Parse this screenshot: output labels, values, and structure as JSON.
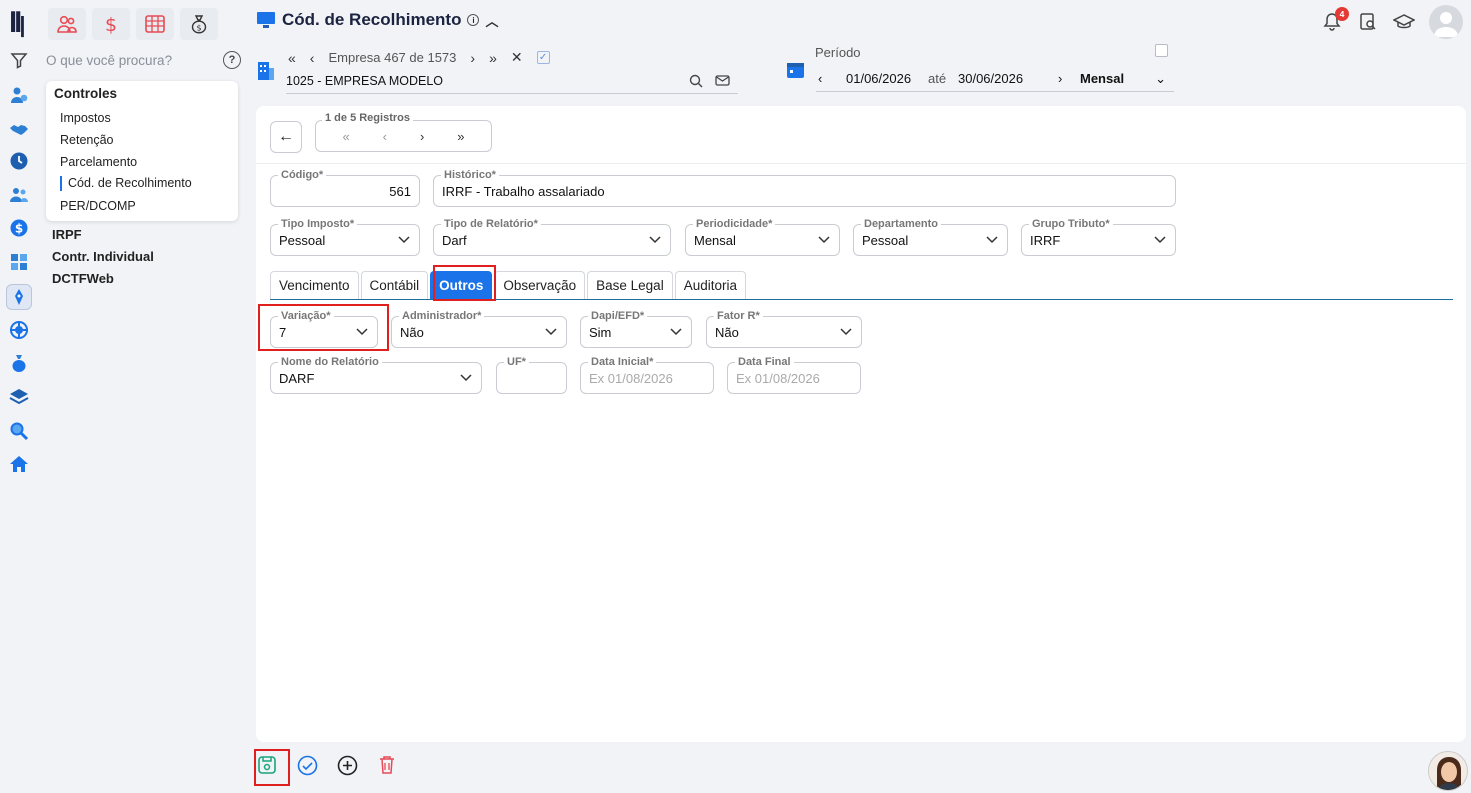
{
  "app": {
    "page_title": "Cód. de Recolhimento"
  },
  "sidebar": {
    "search_placeholder": "O que você procura?",
    "submenu_title": "Controles",
    "submenu_items": [
      "Impostos",
      "Retenção",
      "Parcelamento",
      "Cód. de Recolhimento",
      "PER/DCOMP"
    ],
    "groups": [
      "IRPF",
      "Contr. Individual",
      "DCTFWeb"
    ]
  },
  "header": {
    "notification_count": "4"
  },
  "empresa": {
    "nav_text": "Empresa 467 de 1573",
    "current": "1025 - EMPRESA MODELO"
  },
  "periodo": {
    "label": "Período",
    "start": "01/06/2026",
    "ate": "até",
    "end": "30/06/2026",
    "tipo": "Mensal"
  },
  "registros": {
    "label": "1 de 5 Registros"
  },
  "form": {
    "codigo": {
      "label": "Código*",
      "value": "561"
    },
    "historico": {
      "label": "Histórico*",
      "value": "IRRF - Trabalho assalariado"
    },
    "tipo_imposto": {
      "label": "Tipo Imposto*",
      "value": "Pessoal"
    },
    "tipo_relatorio": {
      "label": "Tipo de Relatório*",
      "value": "Darf"
    },
    "periodicidade": {
      "label": "Periodicidade*",
      "value": "Mensal"
    },
    "departamento": {
      "label": "Departamento",
      "value": "Pessoal"
    },
    "grupo_tributo": {
      "label": "Grupo Tributo*",
      "value": "IRRF"
    }
  },
  "tabs": [
    "Vencimento",
    "Contábil",
    "Outros",
    "Observação",
    "Base Legal",
    "Auditoria"
  ],
  "outros": {
    "variacao": {
      "label": "Variação*",
      "value": "7"
    },
    "administrador": {
      "label": "Administrador*",
      "value": "Não"
    },
    "dapi": {
      "label": "Dapi/EFD*",
      "value": "Sim"
    },
    "fator_r": {
      "label": "Fator R*",
      "value": "Não"
    },
    "nome_relatorio": {
      "label": "Nome do Relatório",
      "value": "DARF"
    },
    "uf": {
      "label": "UF*",
      "value": ""
    },
    "data_inicial": {
      "label": "Data Inicial*",
      "placeholder": "Ex 01/08/2026"
    },
    "data_final": {
      "label": "Data Final",
      "placeholder": "Ex 01/08/2026"
    }
  },
  "colors": {
    "accent": "#1a73e8",
    "highlight": "#e0201f",
    "brand_red": "#e84b55"
  }
}
